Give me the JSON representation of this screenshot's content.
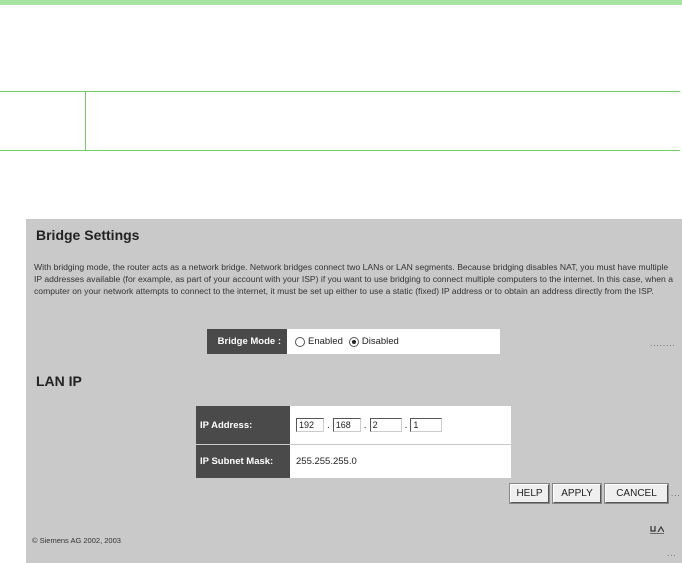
{
  "note": {
    "left_text": "",
    "right_text": ""
  },
  "bridge": {
    "title": "Bridge Settings",
    "description": "With bridging mode, the router acts as a network bridge. Network bridges connect two LANs or LAN segments. Because bridging disables NAT, you must have multiple IP addresses available (for example, as part of your account with your ISP) if you want to use bridging to connect multiple computers to the internet. In this case, when a computer on your network attempts to connect to the internet, it must be set up either to use a static (fixed) IP address or to obtain an address directly from the ISP.",
    "mode_label": "Bridge Mode :",
    "option_enabled": "Enabled",
    "option_disabled": "Disabled",
    "selected": "Disabled"
  },
  "lan": {
    "title": "LAN IP",
    "ip_label": "IP Address:",
    "ip_octets": [
      "192",
      "168",
      "2",
      "1"
    ],
    "subnet_label": "IP Subnet Mask:",
    "subnet_value": "255.255.255.0"
  },
  "buttons": {
    "help": "HELP",
    "apply": "APPLY",
    "cancel": "CANCEL"
  },
  "footer": {
    "copyright": "© Siemens AG 2002, 2003"
  },
  "decor": {
    "dots": "........",
    "dots_short": "...",
    "up_icon": "up-arrow-icon"
  }
}
